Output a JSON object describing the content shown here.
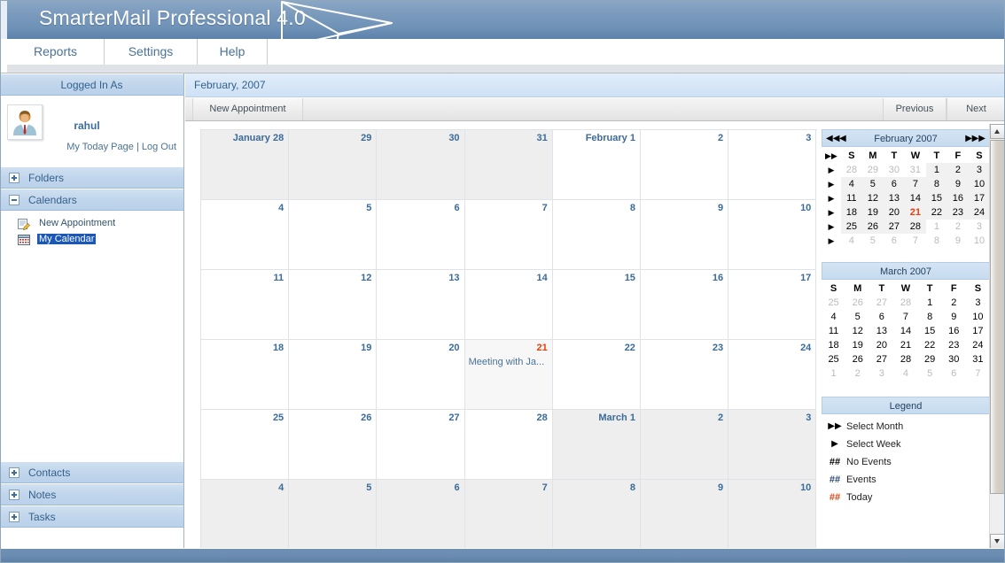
{
  "app": {
    "title": "SmarterMail Professional 4.0",
    "logo_icon": "envelope-icon"
  },
  "menu": {
    "items": [
      {
        "label": "Reports"
      },
      {
        "label": "Settings"
      },
      {
        "label": "Help"
      }
    ]
  },
  "sidebar": {
    "logged_in_header": "Logged In As",
    "username": "rahul",
    "avatar_icon": "user-avatar-icon",
    "links": {
      "today_page": "My Today Page",
      "separator": "|",
      "logout": "Log Out"
    },
    "sections": [
      {
        "label": "Folders",
        "state": "collapsed"
      },
      {
        "label": "Calendars",
        "state": "expanded"
      },
      {
        "label": "Contacts",
        "state": "collapsed"
      },
      {
        "label": "Notes",
        "state": "collapsed"
      },
      {
        "label": "Tasks",
        "state": "collapsed"
      }
    ],
    "calendar_items": [
      {
        "label": "New Appointment",
        "icon": "new-appointment-icon",
        "selected": false
      },
      {
        "label": "My Calendar",
        "icon": "calendar-icon",
        "selected": true
      }
    ]
  },
  "main": {
    "title": "February, 2007",
    "toolbar": {
      "new_appointment": "New Appointment",
      "previous": "Previous",
      "next": "Next"
    }
  },
  "calendar_grid": {
    "rows": [
      [
        {
          "label": "January 28",
          "type": "other"
        },
        {
          "label": "29",
          "type": "other"
        },
        {
          "label": "30",
          "type": "other"
        },
        {
          "label": "31",
          "type": "other"
        },
        {
          "label": "February 1",
          "type": "normal"
        },
        {
          "label": "2",
          "type": "normal"
        },
        {
          "label": "3",
          "type": "normal"
        }
      ],
      [
        {
          "label": "4",
          "type": "normal"
        },
        {
          "label": "5",
          "type": "normal"
        },
        {
          "label": "6",
          "type": "normal"
        },
        {
          "label": "7",
          "type": "normal"
        },
        {
          "label": "8",
          "type": "normal"
        },
        {
          "label": "9",
          "type": "normal"
        },
        {
          "label": "10",
          "type": "normal"
        }
      ],
      [
        {
          "label": "11",
          "type": "normal"
        },
        {
          "label": "12",
          "type": "normal"
        },
        {
          "label": "13",
          "type": "normal"
        },
        {
          "label": "14",
          "type": "normal"
        },
        {
          "label": "15",
          "type": "normal"
        },
        {
          "label": "16",
          "type": "normal"
        },
        {
          "label": "17",
          "type": "normal"
        }
      ],
      [
        {
          "label": "18",
          "type": "normal"
        },
        {
          "label": "19",
          "type": "normal"
        },
        {
          "label": "20",
          "type": "normal"
        },
        {
          "label": "21",
          "type": "today",
          "event": "Meeting with Ja..."
        },
        {
          "label": "22",
          "type": "normal"
        },
        {
          "label": "23",
          "type": "normal"
        },
        {
          "label": "24",
          "type": "normal"
        }
      ],
      [
        {
          "label": "25",
          "type": "normal"
        },
        {
          "label": "26",
          "type": "normal"
        },
        {
          "label": "27",
          "type": "normal"
        },
        {
          "label": "28",
          "type": "normal"
        },
        {
          "label": "March 1",
          "type": "other"
        },
        {
          "label": "2",
          "type": "other"
        },
        {
          "label": "3",
          "type": "other"
        }
      ],
      [
        {
          "label": "4",
          "type": "other"
        },
        {
          "label": "5",
          "type": "other"
        },
        {
          "label": "6",
          "type": "other"
        },
        {
          "label": "7",
          "type": "other"
        },
        {
          "label": "8",
          "type": "other"
        },
        {
          "label": "9",
          "type": "other"
        },
        {
          "label": "10",
          "type": "other"
        }
      ]
    ]
  },
  "mini_calendars": [
    {
      "id": "february",
      "title": "February 2007",
      "has_nav": true,
      "nav": {
        "first": "◀◀",
        "prev": "◀",
        "next": "▶",
        "last": "▶▶"
      },
      "select_month_icon": "▶▶",
      "week_arrow": "▶",
      "dow": [
        "S",
        "M",
        "T",
        "W",
        "T",
        "F",
        "S"
      ],
      "weeks": [
        [
          {
            "d": "28",
            "s": "dim"
          },
          {
            "d": "29",
            "s": "dim"
          },
          {
            "d": "30",
            "s": "dim"
          },
          {
            "d": "31",
            "s": "dim"
          },
          {
            "d": "1",
            "s": "in"
          },
          {
            "d": "2",
            "s": "in"
          },
          {
            "d": "3",
            "s": "in"
          }
        ],
        [
          {
            "d": "4",
            "s": "in"
          },
          {
            "d": "5",
            "s": "in"
          },
          {
            "d": "6",
            "s": "in"
          },
          {
            "d": "7",
            "s": "in"
          },
          {
            "d": "8",
            "s": "in"
          },
          {
            "d": "9",
            "s": "in"
          },
          {
            "d": "10",
            "s": "in"
          }
        ],
        [
          {
            "d": "11",
            "s": "in"
          },
          {
            "d": "12",
            "s": "in"
          },
          {
            "d": "13",
            "s": "in"
          },
          {
            "d": "14",
            "s": "in"
          },
          {
            "d": "15",
            "s": "in"
          },
          {
            "d": "16",
            "s": "in"
          },
          {
            "d": "17",
            "s": "in"
          }
        ],
        [
          {
            "d": "18",
            "s": "in"
          },
          {
            "d": "19",
            "s": "in"
          },
          {
            "d": "20",
            "s": "in"
          },
          {
            "d": "21",
            "s": "today"
          },
          {
            "d": "22",
            "s": "in"
          },
          {
            "d": "23",
            "s": "in"
          },
          {
            "d": "24",
            "s": "in"
          }
        ],
        [
          {
            "d": "25",
            "s": "in"
          },
          {
            "d": "26",
            "s": "in"
          },
          {
            "d": "27",
            "s": "in"
          },
          {
            "d": "28",
            "s": "in"
          },
          {
            "d": "1",
            "s": "dim"
          },
          {
            "d": "2",
            "s": "dim"
          },
          {
            "d": "3",
            "s": "dim"
          }
        ],
        [
          {
            "d": "4",
            "s": "dim"
          },
          {
            "d": "5",
            "s": "dim"
          },
          {
            "d": "6",
            "s": "dim"
          },
          {
            "d": "7",
            "s": "dim"
          },
          {
            "d": "8",
            "s": "dim"
          },
          {
            "d": "9",
            "s": "dim"
          },
          {
            "d": "10",
            "s": "dim"
          }
        ]
      ]
    },
    {
      "id": "march",
      "title": "March 2007",
      "has_nav": false,
      "dow": [
        "S",
        "M",
        "T",
        "W",
        "T",
        "F",
        "S"
      ],
      "weeks": [
        [
          {
            "d": "25",
            "s": "dim"
          },
          {
            "d": "26",
            "s": "dim"
          },
          {
            "d": "27",
            "s": "dim"
          },
          {
            "d": "28",
            "s": "dim"
          },
          {
            "d": "1",
            "s": "in"
          },
          {
            "d": "2",
            "s": "in"
          },
          {
            "d": "3",
            "s": "in"
          }
        ],
        [
          {
            "d": "4",
            "s": "in"
          },
          {
            "d": "5",
            "s": "in"
          },
          {
            "d": "6",
            "s": "in"
          },
          {
            "d": "7",
            "s": "in"
          },
          {
            "d": "8",
            "s": "in"
          },
          {
            "d": "9",
            "s": "in"
          },
          {
            "d": "10",
            "s": "in"
          }
        ],
        [
          {
            "d": "11",
            "s": "in"
          },
          {
            "d": "12",
            "s": "in"
          },
          {
            "d": "13",
            "s": "in"
          },
          {
            "d": "14",
            "s": "in"
          },
          {
            "d": "15",
            "s": "in"
          },
          {
            "d": "16",
            "s": "in"
          },
          {
            "d": "17",
            "s": "in"
          }
        ],
        [
          {
            "d": "18",
            "s": "in"
          },
          {
            "d": "19",
            "s": "in"
          },
          {
            "d": "20",
            "s": "in"
          },
          {
            "d": "21",
            "s": "in"
          },
          {
            "d": "22",
            "s": "in"
          },
          {
            "d": "23",
            "s": "in"
          },
          {
            "d": "24",
            "s": "in"
          }
        ],
        [
          {
            "d": "25",
            "s": "in"
          },
          {
            "d": "26",
            "s": "in"
          },
          {
            "d": "27",
            "s": "in"
          },
          {
            "d": "28",
            "s": "in"
          },
          {
            "d": "29",
            "s": "in"
          },
          {
            "d": "30",
            "s": "in"
          },
          {
            "d": "31",
            "s": "in"
          }
        ],
        [
          {
            "d": "1",
            "s": "dim"
          },
          {
            "d": "2",
            "s": "dim"
          },
          {
            "d": "3",
            "s": "dim"
          },
          {
            "d": "4",
            "s": "dim"
          },
          {
            "d": "5",
            "s": "dim"
          },
          {
            "d": "6",
            "s": "dim"
          },
          {
            "d": "7",
            "s": "dim"
          }
        ]
      ]
    }
  ],
  "legend": {
    "title": "Legend",
    "rows": [
      {
        "icon": "▶▶",
        "icon_kind": "arrow",
        "label": "Select Month"
      },
      {
        "icon": "▶",
        "icon_kind": "arrow",
        "label": "Select Week"
      },
      {
        "icon": "##",
        "icon_kind": "hash",
        "label": "No Events"
      },
      {
        "icon": "##",
        "icon_kind": "hash blue",
        "label": "Events"
      },
      {
        "icon": "##",
        "icon_kind": "hash red",
        "label": "Today"
      }
    ]
  },
  "colors": {
    "header_blue": "#7b9bbd",
    "panel_blue": "#c1d6ec",
    "accent_text": "#35618c",
    "today_red": "#e8400c",
    "selected_blue": "#1b57b5"
  },
  "scrollbar": {
    "up_icon": "scroll-up-icon",
    "down_icon": "scroll-down-icon"
  }
}
